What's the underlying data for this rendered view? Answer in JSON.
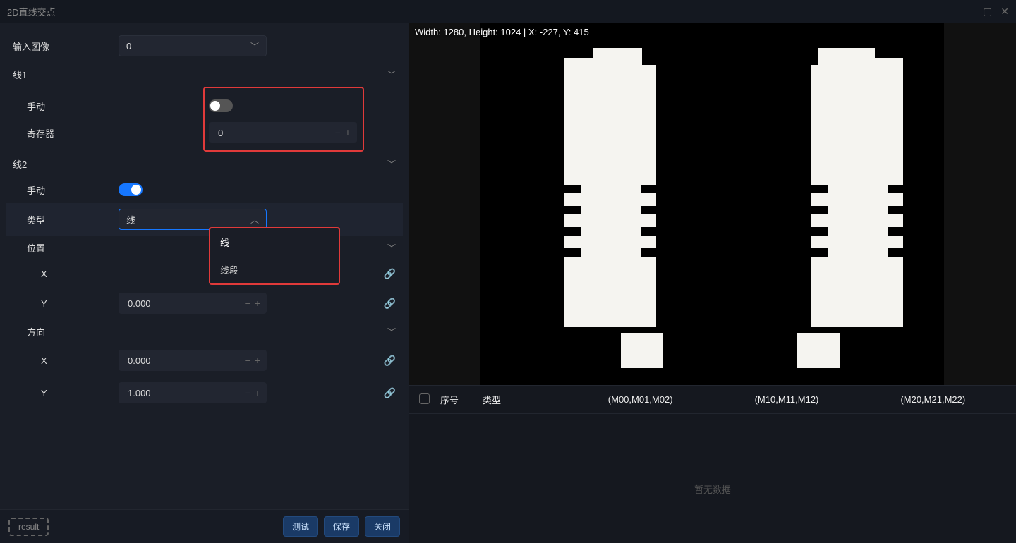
{
  "window_title": "2D直线交点",
  "left": {
    "input_image": {
      "label": "输入图像",
      "value": "0"
    },
    "line1": {
      "title": "线1",
      "manual_label": "手动",
      "manual_on": false,
      "register_label": "寄存器",
      "register_value": "0"
    },
    "line2": {
      "title": "线2",
      "manual_label": "手动",
      "manual_on": true,
      "type_label": "类型",
      "type_value": "线",
      "type_options": [
        "线",
        "线段"
      ],
      "position": {
        "label": "位置",
        "x_label": "X",
        "y_label": "Y",
        "y_value": "0.000"
      },
      "direction": {
        "label": "方向",
        "x_label": "X",
        "x_value": "0.000",
        "y_label": "Y",
        "y_value": "1.000"
      }
    }
  },
  "footer": {
    "result_tag": "result",
    "test": "测试",
    "save": "保存",
    "close": "关闭"
  },
  "image": {
    "info": "Width: 1280, Height: 1024 | X: -227, Y: 415"
  },
  "table": {
    "col_index": "序号",
    "col_type": "类型",
    "col_m0": "(M00,M01,M02)",
    "col_m1": "(M10,M11,M12)",
    "col_m2": "(M20,M21,M22)",
    "empty": "暂无数据"
  }
}
